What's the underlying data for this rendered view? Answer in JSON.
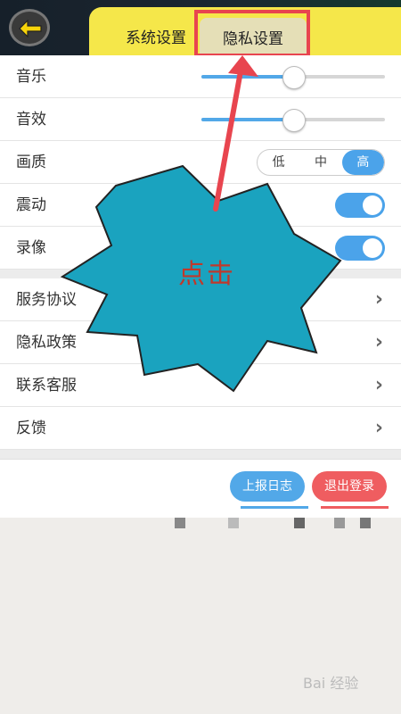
{
  "tabs": {
    "system": "系统设置",
    "privacy": "隐私设置"
  },
  "rows": {
    "music": {
      "label": "音乐",
      "value": 0.5
    },
    "sound": {
      "label": "音效",
      "value": 0.5
    },
    "quality": {
      "label": "画质",
      "options": [
        "低",
        "中",
        "高"
      ],
      "selected": "高"
    },
    "vibration": {
      "label": "震动",
      "on": true
    },
    "recording": {
      "label": "录像",
      "on": true
    },
    "service": {
      "label": "服务协议"
    },
    "privacy_policy": {
      "label": "隐私政策"
    },
    "contact": {
      "label": "联系客服"
    },
    "feedback": {
      "label": "反馈"
    }
  },
  "buttons": {
    "upload_log": "上报日志",
    "logout": "退出登录"
  },
  "annotation": {
    "text": "点击"
  },
  "watermark": "Bai 经验",
  "colors": {
    "accent": "#4ba3ea",
    "danger": "#ef5d60",
    "highlight": "#e8454f",
    "burst": "#1aa3bf"
  }
}
